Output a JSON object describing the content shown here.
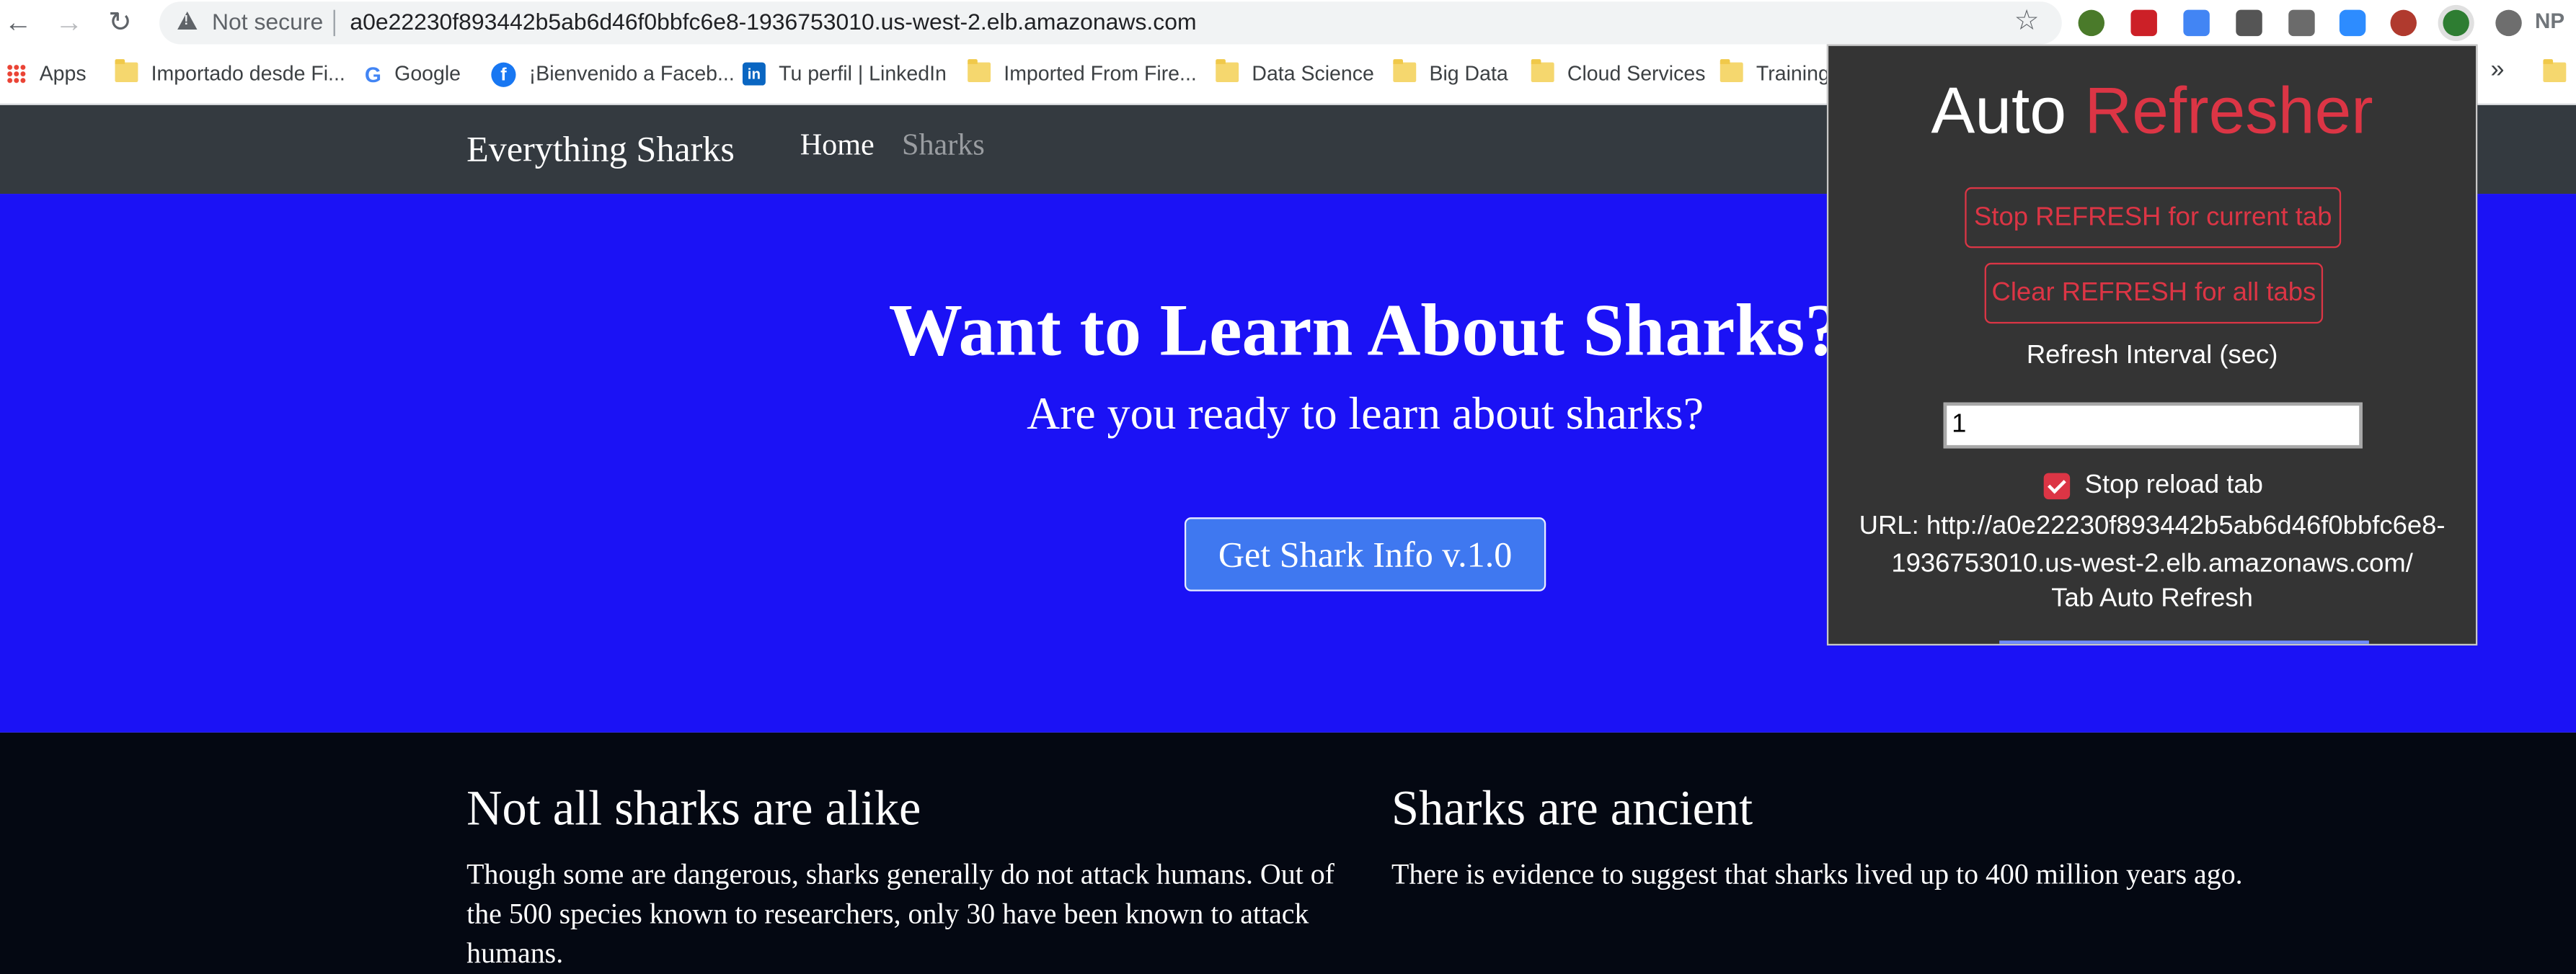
{
  "browser": {
    "address": {
      "security_label": "Not secure",
      "url": "a0e22230f893442b5ab6d46f0bbfc6e8-1936753010.us-west-2.elb.amazonaws.com"
    },
    "extensions": [
      {
        "name": "globe-extension-icon",
        "color": "#4a7a2a"
      },
      {
        "name": "lastpass-extension-icon",
        "color": "#cc2027"
      },
      {
        "name": "translate-extension-icon",
        "color": "#4285f4"
      },
      {
        "name": "bulb-extension-icon",
        "color": "#555555"
      },
      {
        "name": "tabs-extension-icon",
        "color": "#6b6b6b"
      },
      {
        "name": "zoom-extension-icon",
        "color": "#2d8cff"
      },
      {
        "name": "grammar-extension-icon",
        "color": "#b03a2e"
      },
      {
        "name": "auto-refresher-extension-icon",
        "color": "#2e7d32"
      },
      {
        "name": "mask-extension-icon",
        "color": "#6e6e6e"
      }
    ],
    "profile_label": "NP",
    "bookmarks": [
      {
        "label": "Apps",
        "icon": "apps-icon"
      },
      {
        "label": "Importado desde Fi...",
        "icon": "folder-icon"
      },
      {
        "label": "Google",
        "icon": "google-icon"
      },
      {
        "label": "¡Bienvenido a Faceb...",
        "icon": "facebook-icon"
      },
      {
        "label": "Tu perfil | LinkedIn",
        "icon": "linkedin-icon"
      },
      {
        "label": "Imported From Fire...",
        "icon": "folder-icon"
      },
      {
        "label": "Data Science",
        "icon": "folder-icon"
      },
      {
        "label": "Big Data",
        "icon": "folder-icon"
      },
      {
        "label": "Cloud Services",
        "icon": "folder-icon"
      },
      {
        "label": "Training",
        "icon": "folder-icon"
      }
    ],
    "bookmarks_overflow": "»"
  },
  "site": {
    "brand": "Everything Sharks",
    "nav": {
      "home": "Home",
      "sharks": "Sharks"
    },
    "hero": {
      "title": "Want to Learn About Sharks?",
      "subtitle": "Are you ready to learn about sharks?",
      "button": "Get Shark Info v.1.0"
    },
    "columns": [
      {
        "heading": "Not all sharks are alike",
        "body": "Though some are dangerous, sharks generally do not attack humans. Out of the 500 species known to researchers, only 30 have been known to attack humans."
      },
      {
        "heading": "Sharks are ancient",
        "body": "There is evidence to suggest that sharks lived up to 400 million years ago."
      }
    ],
    "colors": {
      "navbar": "#343a40",
      "hero": "#1b12f5",
      "button": "#3f78f0",
      "dark_section": "#040812"
    }
  },
  "popup": {
    "title_part1": "Auto",
    "title_part2": "Refresher",
    "stop_button": "Stop REFRESH for current tab",
    "clear_button": "Clear REFRESH for all tabs",
    "interval_label": "Refresh Interval (sec)",
    "interval_value": "1",
    "checkbox_label": "Stop reload tab",
    "checkbox_checked": true,
    "url_line1": "URL: http://a0e22230f893442b5ab6d46f0bbfc6e8-",
    "url_line2": "1936753010.us-west-2.elb.amazonaws.com/",
    "footer": "Tab Auto Refresh",
    "accent_color": "#dc3545"
  }
}
